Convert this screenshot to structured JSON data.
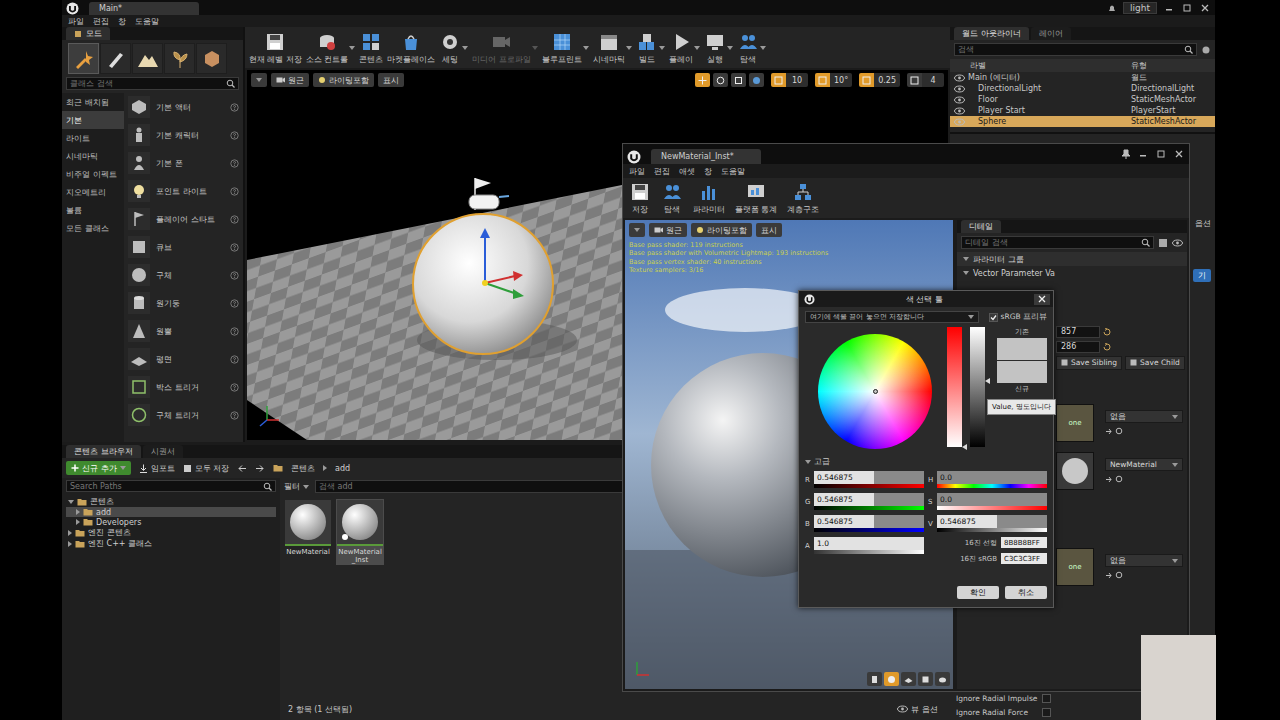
{
  "editor": {
    "tab": "Main*",
    "project": "light",
    "menu": [
      "파일",
      "편집",
      "창",
      "도움말"
    ]
  },
  "modes": {
    "title": "모드",
    "tools": [
      {
        "selected": true
      },
      {
        "selected": false
      },
      {
        "selected": false
      },
      {
        "selected": false
      },
      {
        "selected": false
      }
    ],
    "search": {
      "placeholder": "클래스 검색"
    },
    "categories": [
      {
        "label": "최근 배치됨",
        "selected": false
      },
      {
        "label": "기본",
        "selected": true
      },
      {
        "label": "라이트",
        "selected": false
      },
      {
        "label": "시네마틱",
        "selected": false
      },
      {
        "label": "비주얼 이펙트",
        "selected": false
      },
      {
        "label": "지오메트리",
        "selected": false
      },
      {
        "label": "볼륨",
        "selected": false
      },
      {
        "label": "모든 클래스",
        "selected": false
      }
    ],
    "items": [
      {
        "label": "기본 액터",
        "kind": "actor"
      },
      {
        "label": "기본 캐릭터",
        "kind": "character"
      },
      {
        "label": "기본 폰",
        "kind": "pawn"
      },
      {
        "label": "포인트 라이트",
        "kind": "light"
      },
      {
        "label": "플레이어 스타트",
        "kind": "start"
      },
      {
        "label": "큐브",
        "kind": "cube"
      },
      {
        "label": "구체",
        "kind": "sphere"
      },
      {
        "label": "원기둥",
        "kind": "cylinder"
      },
      {
        "label": "원뿔",
        "kind": "cone"
      },
      {
        "label": "평면",
        "kind": "plane"
      },
      {
        "label": "박스 트리거",
        "kind": "boxtrigger"
      },
      {
        "label": "구체 트리거",
        "kind": "spheretrigger"
      }
    ]
  },
  "toolbar": [
    {
      "label": "현재 레벨 저장",
      "kind": "save",
      "dropdown": false,
      "disabled": false
    },
    {
      "label": "소스 컨트롤",
      "kind": "source",
      "dropdown": true,
      "disabled": false
    },
    {
      "label": "콘텐츠",
      "kind": "content",
      "dropdown": false,
      "disabled": false
    },
    {
      "label": "마켓플레이스",
      "kind": "market",
      "dropdown": false,
      "disabled": false
    },
    {
      "label": "세팅",
      "kind": "settings",
      "dropdown": true,
      "disabled": false
    },
    {
      "label": "미디어 프로파일",
      "kind": "media",
      "dropdown": true,
      "disabled": true
    },
    {
      "label": "블루프린트",
      "kind": "blueprint",
      "dropdown": true,
      "disabled": false
    },
    {
      "label": "시네마틱",
      "kind": "cinematic",
      "dropdown": true,
      "disabled": false
    },
    {
      "label": "빌드",
      "kind": "build",
      "dropdown": true,
      "disabled": false
    },
    {
      "label": "플레이",
      "kind": "play",
      "dropdown": true,
      "disabled": false
    },
    {
      "label": "실행",
      "kind": "launch",
      "dropdown": true,
      "disabled": false
    },
    {
      "label": "탐색",
      "kind": "browse",
      "dropdown": true,
      "disabled": false
    }
  ],
  "viewport": {
    "buttons": [
      {
        "label": "원근",
        "kind": "camera"
      },
      {
        "label": "라이팅포함",
        "kind": "lit"
      },
      {
        "label": "표시",
        "kind": "show"
      }
    ],
    "transform_tools": [
      {
        "selected": true
      },
      {
        "selected": false
      },
      {
        "selected": false
      },
      {
        "selected": false
      }
    ],
    "snaps": [
      {
        "label": "10",
        "on": true
      },
      {
        "label": "10°",
        "on": true
      },
      {
        "label": "0.25",
        "on": true
      },
      {
        "label": "4",
        "on": false
      }
    ]
  },
  "outliner": {
    "tabs": [
      {
        "label": "월드 아웃라이너",
        "selected": true
      },
      {
        "label": "레이어",
        "selected": false
      }
    ],
    "search": {
      "placeholder": "검색"
    },
    "columns": [
      "라벨",
      "유형"
    ],
    "root": {
      "label": "Main (에디터)",
      "type": "월드",
      "selected": false,
      "children": [
        {
          "label": "DirectionalLight",
          "type": "DirectionalLight",
          "selected": false
        },
        {
          "label": "Floor",
          "type": "StaticMeshActor",
          "selected": false
        },
        {
          "label": "Player Start",
          "type": "PlayerStart",
          "selected": false
        },
        {
          "label": "Sphere",
          "type": "StaticMeshActor",
          "selected": true
        }
      ]
    }
  },
  "level_details": {
    "view_options": "옵션",
    "button": "기",
    "rows": [
      {
        "label": "Ignore Radial Impulse",
        "checked": false
      },
      {
        "label": "Ignore Radial Force",
        "checked": false
      }
    ]
  },
  "content_browser": {
    "tabs": [
      {
        "label": "콘텐츠 브라우저",
        "selected": true
      },
      {
        "label": "시퀀서",
        "selected": false
      }
    ],
    "add_new": "신규 추가",
    "import": "임포트",
    "save_all": "모두 저장",
    "path": [
      "콘텐츠",
      "add"
    ],
    "path_search": {
      "placeholder": "Search Paths"
    },
    "tree": [
      {
        "label": "콘텐츠",
        "expanded": true,
        "selected": false,
        "children": [
          {
            "label": "add",
            "expanded": false,
            "selected": true,
            "children": []
          },
          {
            "label": "Developers",
            "expanded": false,
            "selected": false,
            "children": []
          }
        ]
      },
      {
        "label": "엔진 콘텐츠",
        "expanded": false,
        "selected": false,
        "children": []
      },
      {
        "label": "엔진 C++ 클래스",
        "expanded": false,
        "selected": false,
        "children": []
      }
    ],
    "filter": "필터",
    "asset_search": {
      "placeholder": "검색 add"
    },
    "assets": [
      {
        "label": "NewMaterial",
        "kind": "material",
        "selected": false
      },
      {
        "label": "NewMaterial_Inst",
        "kind": "instance",
        "selected": true
      }
    ],
    "status": "2 항목 (1 선택됨)",
    "view_options": "뷰 옵션"
  },
  "material_editor": {
    "tab": "NewMaterial_Inst*",
    "menu": [
      "파일",
      "편집",
      "애셋",
      "창",
      "도움말"
    ],
    "toolbar": [
      {
        "label": "저장",
        "kind": "save"
      },
      {
        "label": "탐색",
        "kind": "browse"
      },
      {
        "label": "파라미터",
        "kind": "params"
      },
      {
        "label": "플랫폼 통계",
        "kind": "stats"
      },
      {
        "label": "계층구조",
        "kind": "hierarchy"
      }
    ],
    "viewport": {
      "buttons": [
        {
          "label": "원근",
          "kind": "camera"
        },
        {
          "label": "라이팅포함",
          "kind": "lit"
        },
        {
          "label": "표시",
          "kind": "show"
        }
      ],
      "stats": [
        "Base pass shader: 119 instructions",
        "Base pass shader with Volumetric Lightmap: 193 instructions",
        "Base pass vertex shader: 40 instructions",
        "Texture samplers: 3/16"
      ],
      "preview_shapes": [
        {
          "selected": false
        },
        {
          "selected": true
        },
        {
          "selected": false
        },
        {
          "selected": false
        },
        {
          "selected": false
        }
      ]
    },
    "details": {
      "tab": "디테일",
      "search": {
        "placeholder": "디테일 검색"
      },
      "group": "파라미터 그룹",
      "parameter": "Vector Parameter Va",
      "fields": [
        "857",
        "286"
      ],
      "buttons": [
        "Save Sibling",
        "Save Child"
      ],
      "slots": [
        {
          "kind": "empty",
          "thumb": "one",
          "value": "없음"
        },
        {
          "kind": "material",
          "thumb": "",
          "value": "NewMaterial"
        },
        {
          "kind": "empty",
          "thumb": "one",
          "value": "없음"
        }
      ]
    }
  },
  "color_picker": {
    "title": "색 선택 툴",
    "swatch_drop": "여기에 색을 끌어 놓으면 저장합니다",
    "srgb": {
      "label": "sRGB 프리뷰",
      "checked": true
    },
    "wheel": {
      "hue": 0,
      "saturation": 0
    },
    "saturation_bar": {
      "level": 0
    },
    "value_bar": {
      "level": 0.546875
    },
    "swatches": [
      {
        "label": "기존",
        "color": "#c3c3c3"
      },
      {
        "label": "신규",
        "color": "#c3c3c3"
      }
    ],
    "tooltip": "Value, 명도입니다",
    "advanced": {
      "label": "고급",
      "expanded": true
    },
    "channels": [
      {
        "label": "R",
        "value": "0.546875",
        "level": 0.546875,
        "kind": "red"
      },
      {
        "label": "G",
        "value": "0.546875",
        "level": 0.546875,
        "kind": "green"
      },
      {
        "label": "B",
        "value": "0.546875",
        "level": 0.546875,
        "kind": "blue"
      },
      {
        "label": "A",
        "value": "1.0",
        "level": 1,
        "kind": "alpha"
      }
    ],
    "hsv": [
      {
        "label": "H",
        "value": "0.0",
        "level": 0,
        "kind": "hue"
      },
      {
        "label": "S",
        "value": "0.0",
        "level": 0,
        "kind": "saturation"
      },
      {
        "label": "V",
        "value": "0.546875",
        "level": 0.546875,
        "kind": "value"
      }
    ],
    "hex": [
      {
        "label": "16진 선형",
        "value": "8B8B8BFF"
      },
      {
        "label": "16진 sRGB",
        "value": "C3C3C3FF"
      }
    ],
    "buttons": [
      {
        "label": "확인",
        "kind": "ok"
      },
      {
        "label": "취소",
        "kind": "cancel"
      }
    ]
  }
}
